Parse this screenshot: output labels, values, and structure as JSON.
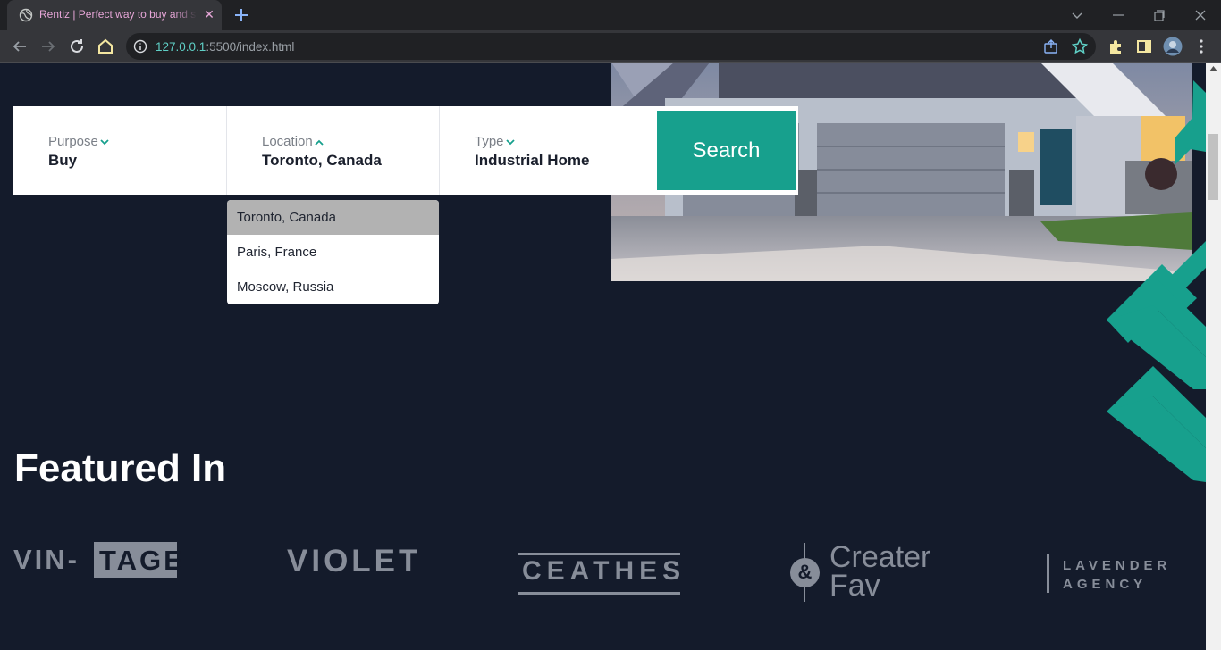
{
  "browser": {
    "tab_title": "Rentiz | Perfect way to buy and sell",
    "tab_close": "✕",
    "url_host": "127.0.0.1",
    "url_rest": ":5500/index.html"
  },
  "search": {
    "fields": [
      {
        "label": "Purpose",
        "value": "Buy"
      },
      {
        "label": "Location",
        "value": "Toronto, Canada"
      },
      {
        "label": "Type",
        "value": "Industrial Home"
      }
    ],
    "button_label": "Search"
  },
  "location_dropdown": {
    "options": [
      "Toronto, Canada",
      "Paris, France",
      "Moscow, Russia"
    ],
    "selected_index": 0
  },
  "featured": {
    "title": "Featured In",
    "logos": {
      "vintage_a": "VIN-",
      "vintage_b": "TAGE",
      "violet": "VIOLET",
      "ceathes": "CEATHES",
      "creater_amp": "&",
      "creater_1": "Creater",
      "creater_2": "Fav",
      "lavender_1": "LAVENDER",
      "lavender_2": "AGENCY"
    }
  },
  "colors": {
    "accent": "#17a08d",
    "page_bg": "#141b2b",
    "logo_gray": "#878d99"
  }
}
